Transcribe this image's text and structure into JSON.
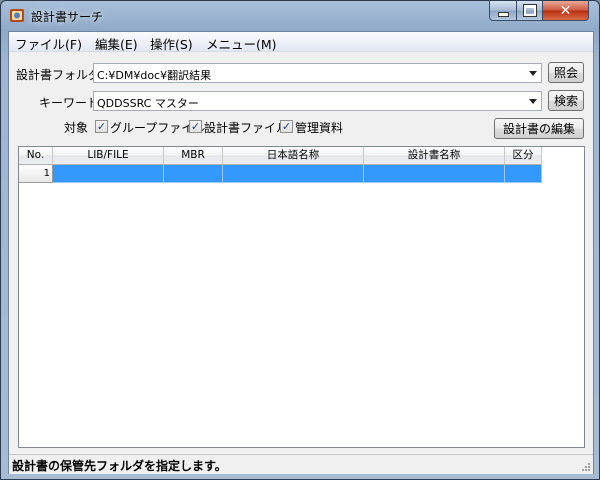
{
  "window": {
    "title": "設計書サーチ"
  },
  "menu": [
    "ファイル(F)",
    "編集(E)",
    "操作(S)",
    "メニュー(M)"
  ],
  "form": {
    "folder_label": "設計書フォルダ",
    "folder_value": "C:¥DM¥doc¥翻訳結果",
    "query_button": "照会",
    "keyword_label": "キーワード",
    "keyword_value": "QDDSSRC マスター",
    "search_button": "検索",
    "target_label": "対象",
    "checkboxes": [
      {
        "label": "グループファイル",
        "checked": true
      },
      {
        "label": "設計書ファイル",
        "checked": true
      },
      {
        "label": "管理資料",
        "checked": true
      }
    ],
    "edit_button": "設計書の編集"
  },
  "grid": {
    "columns": [
      "No.",
      "LIB/FILE",
      "MBR",
      "日本語名称",
      "設計書名称",
      "区分"
    ],
    "rows": [
      {
        "no": "1"
      }
    ]
  },
  "status": {
    "text": "設計書の保管先フォルダを指定します。"
  }
}
